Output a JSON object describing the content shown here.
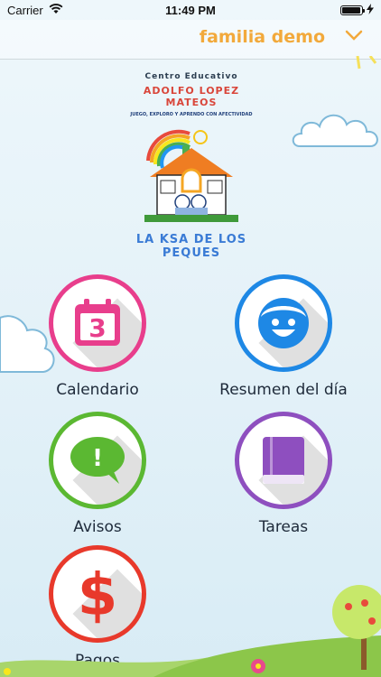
{
  "status": {
    "carrier": "Carrier",
    "time": "11:49 PM",
    "battery_level": 0.95
  },
  "header": {
    "family_name": "familia demo"
  },
  "logo": {
    "line1": "Centro Educativo",
    "line2": "ADOLFO LOPEZ MATEOS",
    "line3": "JUEGO, EXPLORO Y APRENDO CON AFECTIVIDAD",
    "line4": "LA KSA DE LOS PEQUES"
  },
  "menu": {
    "items": [
      {
        "label": "Calendario",
        "icon": "calendar-icon",
        "color": "#e83e8c",
        "badge": "3"
      },
      {
        "label": "Resumen del día",
        "icon": "smiley-face-icon",
        "color": "#1e88e5"
      },
      {
        "label": "Avisos",
        "icon": "chat-alert-icon",
        "color": "#5bb832",
        "badge": "!"
      },
      {
        "label": "Tareas",
        "icon": "book-icon",
        "color": "#8e4fbf"
      },
      {
        "label": "Pagos",
        "icon": "dollar-icon",
        "color": "#e8392b",
        "badge": "$"
      }
    ]
  }
}
